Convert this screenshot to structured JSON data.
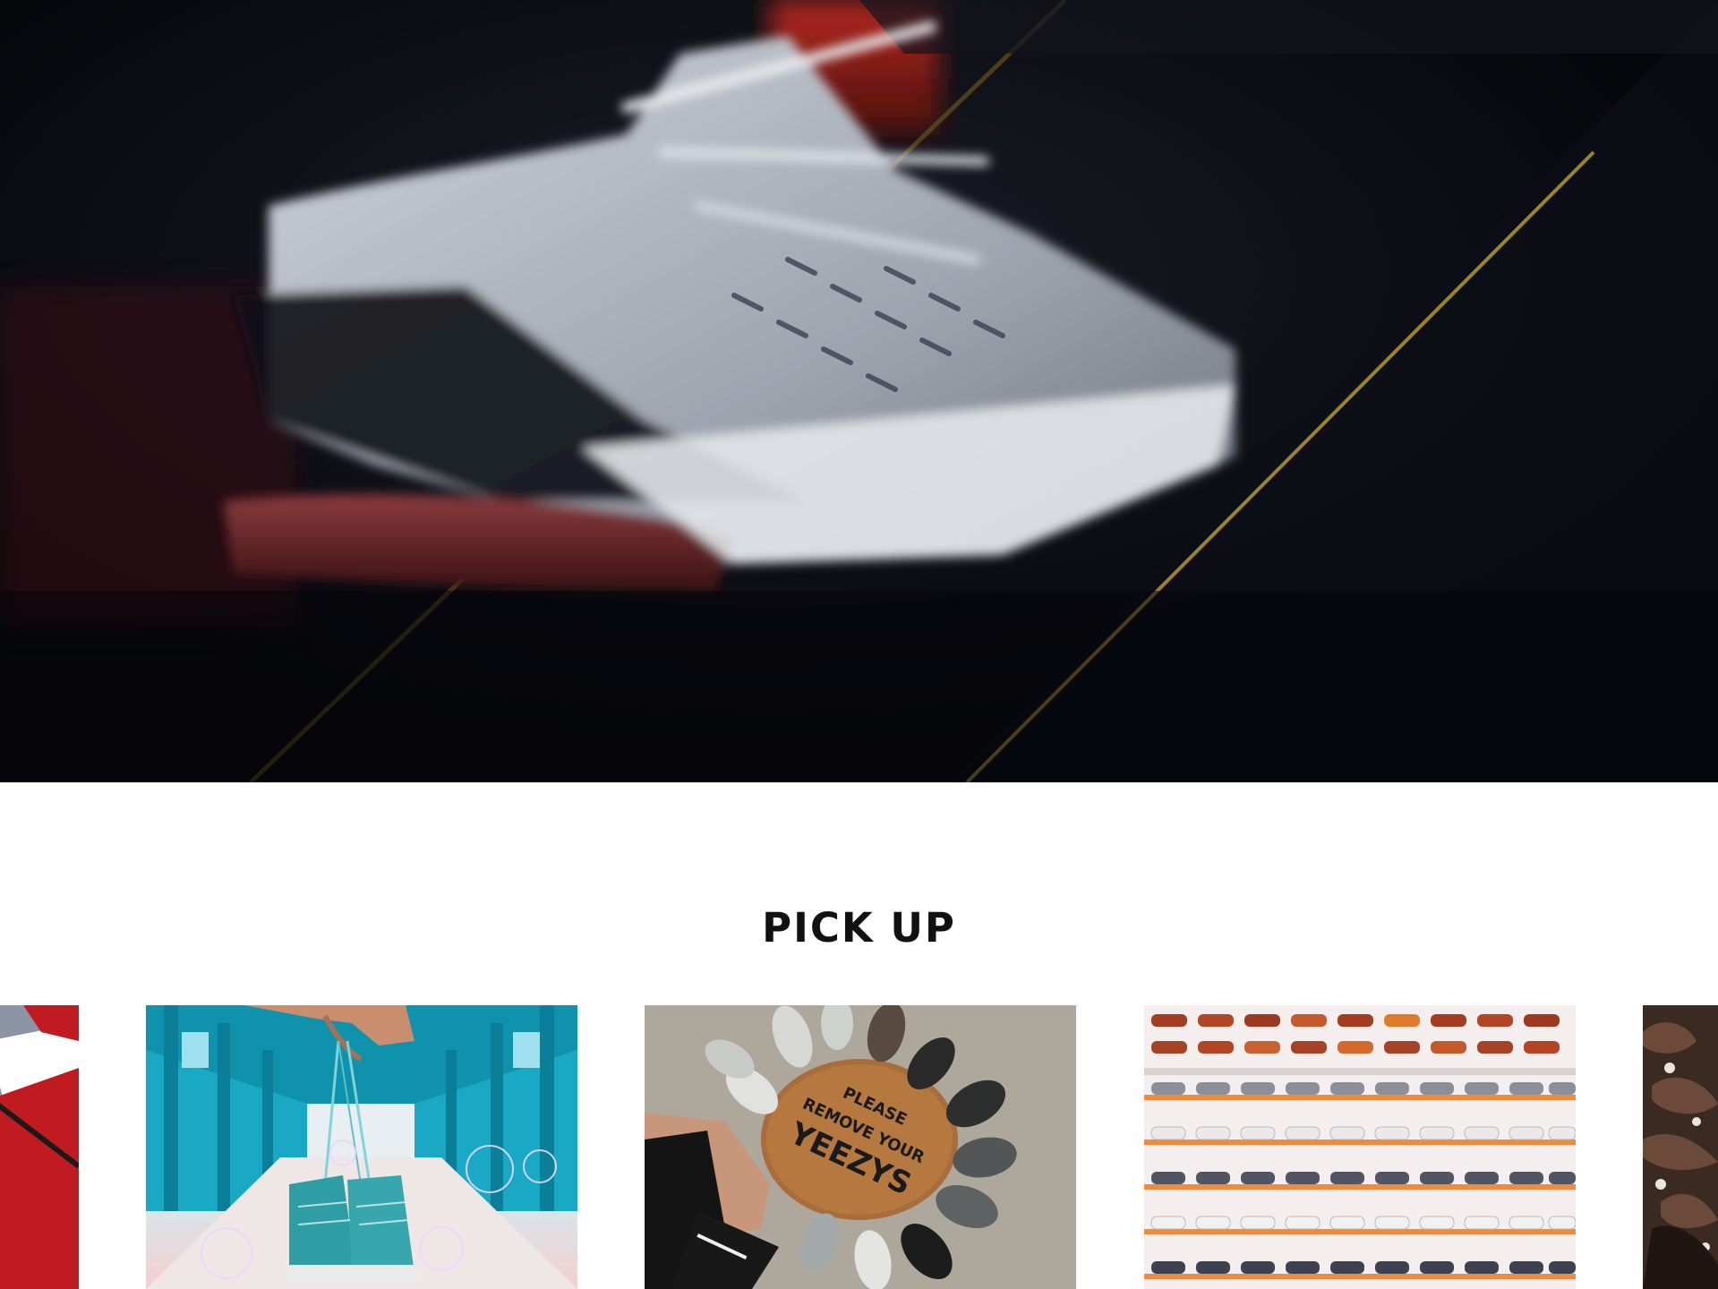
{
  "hero": {
    "image": "sneaker-in-motion-photo"
  },
  "pickup": {
    "title": "PICK UP",
    "cards": [
      {
        "image": "red-and-white-sneaker-on-cobblestone-photo"
      },
      {
        "image": "hand-holding-teal-sneakers-on-bridge-photo"
      },
      {
        "image": "sneakers-around-doormat-photo",
        "doormat_text": [
          "PLEASE",
          "REMOVE YOUR",
          "YEEZYS"
        ]
      },
      {
        "image": "sneaker-store-wall-display-photo"
      },
      {
        "image": "chocolate-dessert-photo"
      }
    ]
  },
  "colors": {
    "title": "#111111",
    "background": "#ffffff",
    "hero_dark": "#06070c"
  }
}
